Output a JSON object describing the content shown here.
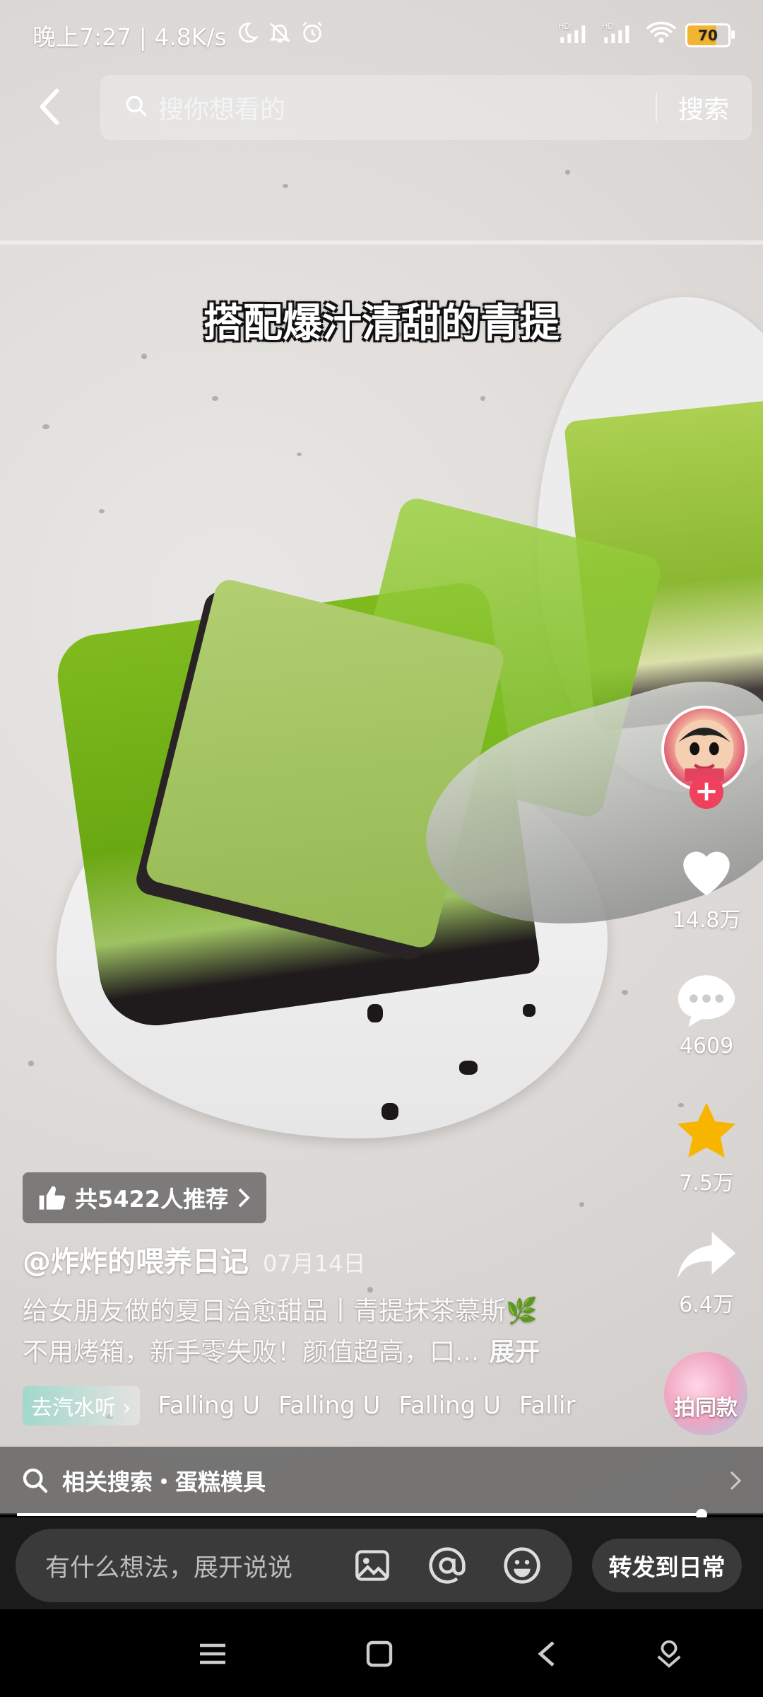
{
  "status_bar": {
    "time_speed": "晚上7:27 | 4.8K/s",
    "battery": "70",
    "icons": [
      "moon-icon",
      "mute-bell-icon",
      "alarm-icon",
      "signal-hd-icon",
      "signal-hd-icon",
      "wifi-icon",
      "battery-icon"
    ]
  },
  "search": {
    "placeholder": "搜你想看的",
    "button": "搜索"
  },
  "video": {
    "caption": "搭配爆汁清甜的青提"
  },
  "rail": {
    "likes": "14.8万",
    "comments": "4609",
    "favorites": "7.5万",
    "shares": "6.4万",
    "same_style": "拍同款",
    "follow": "+"
  },
  "info": {
    "recommend": "共5422人推荐",
    "author": "@炸炸的喂养日记",
    "date": "07月14日",
    "desc_line1": "给女朋友做的夏日治愈甜品丨青提抹茶慕斯🌿",
    "desc_line2": "不用烤箱，新手零失败！颜值超高，口...",
    "expand": "展开",
    "music_tag": "去汽水听",
    "tracks": [
      "Falling U",
      "Falling U",
      "Falling U",
      "Fallir"
    ]
  },
  "related": {
    "label": "相关搜索・蛋糕模具"
  },
  "comment_bar": {
    "placeholder": "有什么想法，展开说说",
    "forward": "转发到日常"
  },
  "colors": {
    "follow_red": "#f0405c",
    "star_yellow": "#f7b500",
    "battery_fill": "#f2b531"
  }
}
